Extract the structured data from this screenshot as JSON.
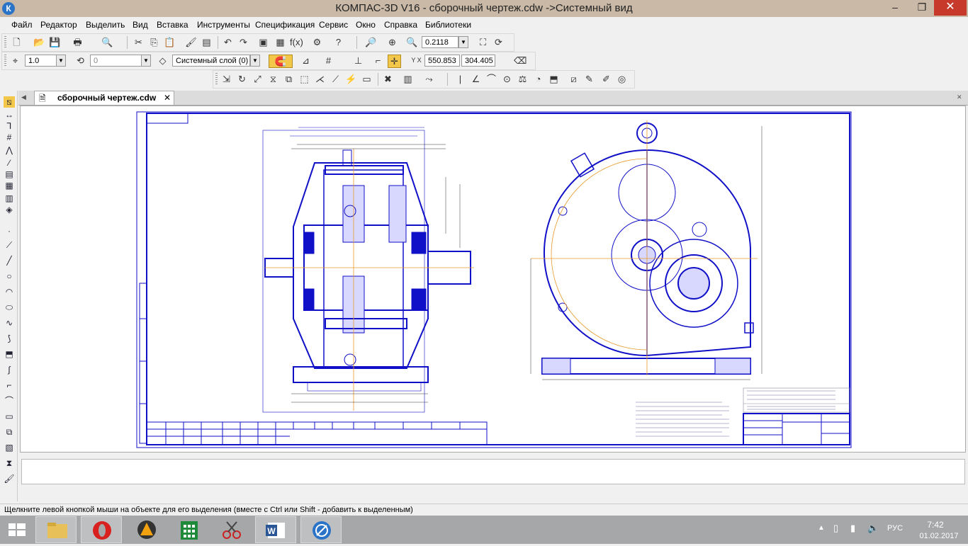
{
  "window": {
    "title": "КОМПАС-3D V16  - сборочный чертеж.cdw ->Системный вид",
    "minimize": "–",
    "restore": "❐",
    "close": "✕",
    "app_icon": "К"
  },
  "menu": [
    "Файл",
    "Редактор",
    "Выделить",
    "Вид",
    "Вставка",
    "Инструменты",
    "Спецификация",
    "Сервис",
    "Окно",
    "Справка",
    "Библиотеки"
  ],
  "toolbar_std": {
    "zoom_value": "0.2118",
    "font_value": "f(x)"
  },
  "toolbar_current": {
    "line_scale": "1.0",
    "step_value": "0",
    "layer": "Системный слой (0)",
    "coord_x": "550.853",
    "coord_y": "304.405"
  },
  "document": {
    "tab_title": "сборочный чертеж.cdw",
    "tab_close": "✕"
  },
  "status": {
    "hint": "Щелкните левой кнопкой мыши на объекте для его выделения (вместе с Ctrl или Shift - добавить к выделенным)"
  },
  "taskbar": {
    "language": "РУС",
    "time": "7:42",
    "date": "01.02.2017"
  },
  "colors": {
    "drawing_blue": "#1010c8",
    "axis_orange": "#e89a2a",
    "titlebar": "#c9b9a6",
    "taskbar": "#a6a7a8"
  }
}
